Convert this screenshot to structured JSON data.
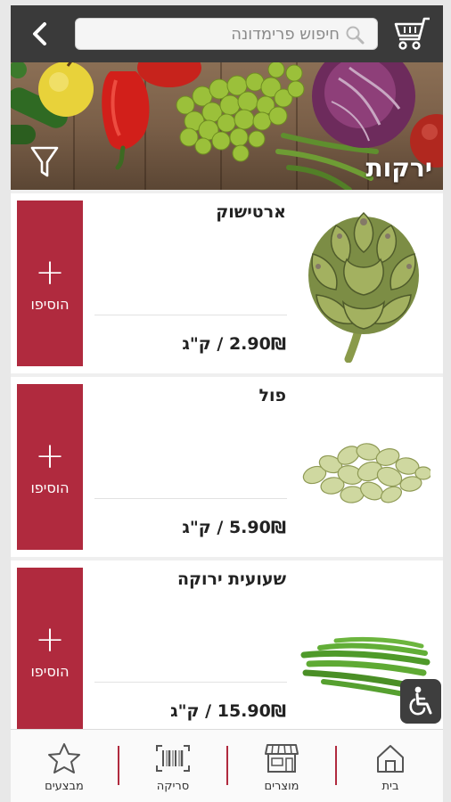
{
  "header": {
    "search_placeholder": "חיפוש פרימדונה"
  },
  "banner": {
    "title": "ירקות"
  },
  "products": [
    {
      "name": "ארטישוק",
      "price": "2.90₪ / ק\"ג",
      "add_label": "הוסיפו",
      "image": "artichoke"
    },
    {
      "name": "פול",
      "price": "5.90₪ / ק\"ג",
      "add_label": "הוסיפו",
      "image": "fava-beans"
    },
    {
      "name": "שעועית ירוקה",
      "price": "15.90₪ / ק\"ג",
      "add_label": "הוסיפו",
      "image": "green-beans"
    }
  ],
  "bottom_nav": [
    {
      "label": "בית",
      "icon": "home-icon"
    },
    {
      "label": "מוצרים",
      "icon": "store-icon"
    },
    {
      "label": "סריקה",
      "icon": "barcode-icon"
    },
    {
      "label": "מבצעים",
      "icon": "star-icon"
    }
  ],
  "colors": {
    "brand_red": "#b02a3e",
    "top_bar": "#3a3a3a"
  }
}
